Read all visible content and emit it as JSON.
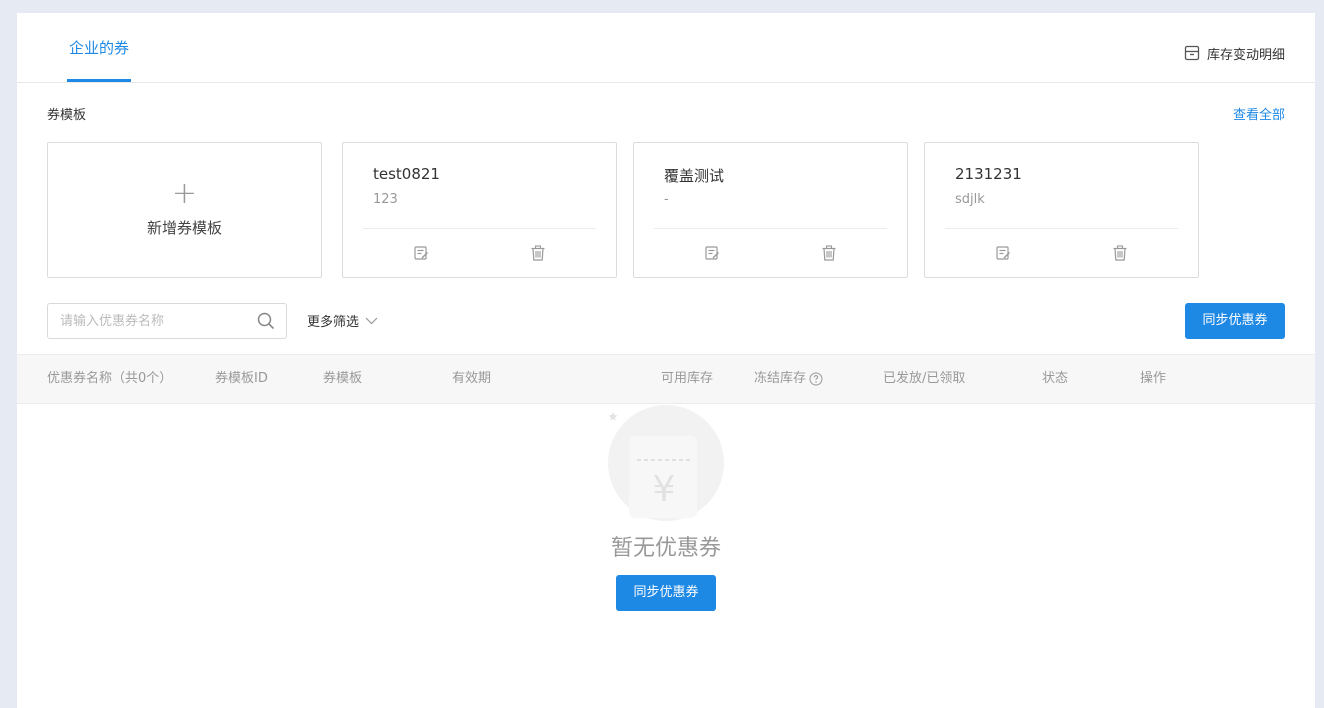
{
  "tabs": [
    {
      "label": "企业的券",
      "active": true
    }
  ],
  "header": {
    "stock_detail_link": "库存变动明细"
  },
  "templates": {
    "section_title": "券模板",
    "view_all": "查看全部",
    "add_label": "新增券模板",
    "cards": [
      {
        "name": "test0821",
        "desc": "123"
      },
      {
        "name": "覆盖测试",
        "desc": "-"
      },
      {
        "name": "2131231",
        "desc": "sdjlk"
      }
    ]
  },
  "filters": {
    "search_placeholder": "请输入优惠券名称",
    "more_filter": "更多筛选"
  },
  "actions": {
    "sync_label": "同步优惠券"
  },
  "table": {
    "columns": [
      "优惠券名称（共0个）",
      "券模板ID",
      "券模板",
      "有效期",
      "可用库存",
      "冻结库存",
      "已发放/已领取",
      "状态",
      "操作"
    ]
  },
  "empty": {
    "text": "暂无优惠券",
    "sync_label": "同步优惠券"
  },
  "colors": {
    "accent": "#1e88e5",
    "page_bg": "#e6eaf3"
  }
}
